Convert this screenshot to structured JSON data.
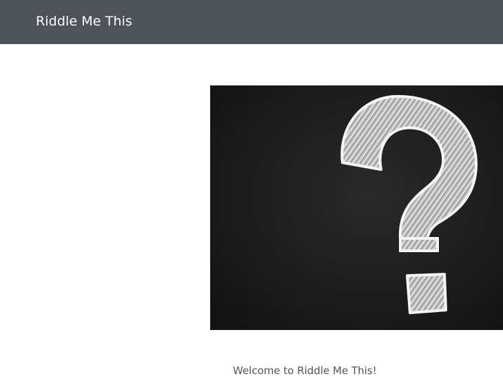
{
  "navbar": {
    "brand": "Riddle Me This",
    "background": "#4e5359"
  },
  "hero": {
    "image_subject": "question-mark-icon",
    "board_color": "#1b1b1b",
    "chalk_color": "#dcdcdc"
  },
  "main": {
    "welcome_text": "Welcome to Riddle Me This!"
  }
}
